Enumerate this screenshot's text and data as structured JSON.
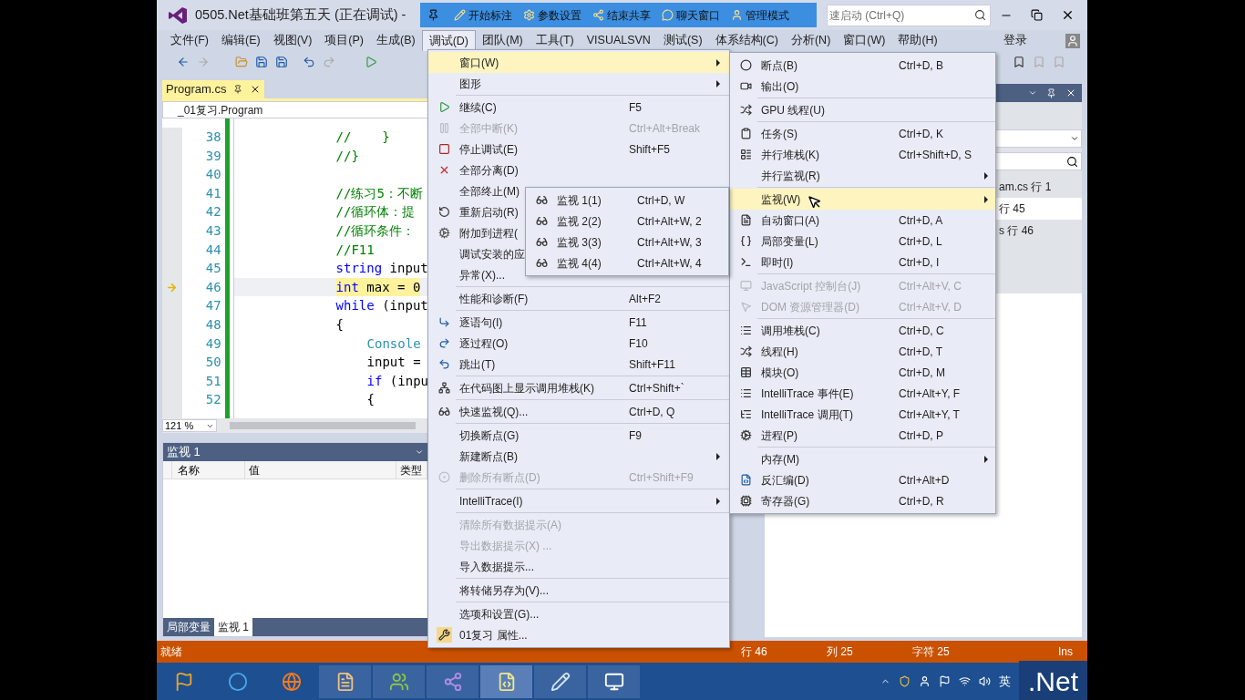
{
  "window": {
    "title": "0505.Net基础班第五天 (正在调试) -",
    "quick_launch": {
      "placeholder": "速启动 (Ctrl+Q)"
    }
  },
  "recorder_toolbar": {
    "items": [
      {
        "label": "开始标注"
      },
      {
        "label": "参数设置"
      },
      {
        "label": "结束共享"
      },
      {
        "label": "聊天窗口"
      },
      {
        "label": "管理模式"
      }
    ]
  },
  "menu_bar": {
    "items": [
      {
        "label": "文件(F)",
        "selected": false
      },
      {
        "label": "编辑(E)",
        "selected": false
      },
      {
        "label": "视图(V)",
        "selected": false
      },
      {
        "label": "项目(P)",
        "selected": false
      },
      {
        "label": "生成(B)",
        "selected": false
      },
      {
        "label": "调试(D)",
        "selected": true
      },
      {
        "label": "团队(M)",
        "selected": false
      },
      {
        "label": "工具(T)",
        "selected": false
      },
      {
        "label": "VISUALSVN",
        "selected": false
      },
      {
        "label": "测试(S)",
        "selected": false
      },
      {
        "label": "体系结构(C)",
        "selected": false
      },
      {
        "label": "分析(N)",
        "selected": false
      },
      {
        "label": "窗口(W)",
        "selected": false
      },
      {
        "label": "帮助(H)",
        "selected": false
      }
    ],
    "sign_in": "登录"
  },
  "editor": {
    "tab": "Program.cs",
    "navigation": "_01复习.Program",
    "zoom": "121 %",
    "lines": [
      {
        "number": "38",
        "current": false,
        "nested": false,
        "tokens": [
          {
            "text": "//    }",
            "kind": "comment"
          }
        ]
      },
      {
        "number": "39",
        "current": false,
        "nested": false,
        "tokens": [
          {
            "text": "//}",
            "kind": "comment"
          }
        ]
      },
      {
        "number": "40"
      },
      {
        "number": "41",
        "current": false,
        "nested": false,
        "tokens": [
          {
            "text": "//练习5：不断",
            "kind": "comment"
          }
        ]
      },
      {
        "number": "42",
        "current": false,
        "nested": false,
        "tokens": [
          {
            "text": "//循环体：提",
            "kind": "comment"
          }
        ]
      },
      {
        "number": "43",
        "current": false,
        "nested": false,
        "tokens": [
          {
            "text": "//循环条件：",
            "kind": "comment"
          }
        ]
      },
      {
        "number": "44",
        "current": false,
        "nested": false,
        "tokens": [
          {
            "text": "//F11",
            "kind": "comment"
          }
        ]
      },
      {
        "number": "45",
        "current": false,
        "nested": false,
        "tokens": [
          {
            "text": "string",
            "kind": "keyword"
          },
          {
            "text": " input",
            "kind": "plain"
          }
        ]
      },
      {
        "number": "46",
        "current": true,
        "nested": false,
        "tokens": [
          {
            "text": "int",
            "kind": "keyword"
          },
          {
            "text": " max = 0",
            "kind": "plain"
          }
        ]
      },
      {
        "number": "47",
        "current": false,
        "nested": false,
        "tokens": [
          {
            "text": "while",
            "kind": "keyword"
          },
          {
            "text": " (input",
            "kind": "plain"
          }
        ]
      },
      {
        "number": "48",
        "current": false,
        "nested": false,
        "tokens": [
          {
            "text": "{",
            "kind": "plain"
          }
        ]
      },
      {
        "number": "49",
        "current": false,
        "nested": true,
        "tokens": [
          {
            "text": "Console",
            "kind": "type"
          }
        ]
      },
      {
        "number": "50",
        "current": false,
        "nested": true,
        "tokens": [
          {
            "text": "input =",
            "kind": "plain"
          }
        ]
      },
      {
        "number": "51",
        "current": false,
        "nested": true,
        "tokens": [
          {
            "text": "if",
            "kind": "keyword"
          },
          {
            "text": " (inpu",
            "kind": "plain"
          }
        ]
      },
      {
        "number": "52",
        "current": false,
        "nested": true,
        "tokens": [
          {
            "text": "{",
            "kind": "plain"
          }
        ]
      }
    ]
  },
  "watch_panel": {
    "title": "监视 1",
    "columns": [
      "名称",
      "值",
      "类型"
    ],
    "tabs": [
      {
        "label": "局部变量",
        "selected": false
      },
      {
        "label": "监视 1",
        "selected": true
      }
    ]
  },
  "right_panel": {
    "rows": [
      {
        "text": "am.cs 行 1",
        "selected": false
      },
      {
        "text": "行 45",
        "selected": true
      },
      {
        "text": "s 行 46",
        "selected": false
      }
    ]
  },
  "debug_menu": {
    "groups": [
      {
        "items": [
          {
            "label": "窗口(W)",
            "submenu": true,
            "selected": true,
            "disabled": false
          },
          {
            "label": "图形",
            "submenu": true,
            "selected": false,
            "disabled": false
          }
        ]
      },
      {
        "items": [
          {
            "label": "继续(C)",
            "shortcut": "F5",
            "submenu": false,
            "selected": false,
            "disabled": false
          },
          {
            "label": "全部中断(K)",
            "shortcut": "Ctrl+Alt+Break",
            "submenu": false,
            "selected": false,
            "disabled": true
          },
          {
            "label": "停止调试(E)",
            "shortcut": "Shift+F5",
            "submenu": false,
            "selected": false,
            "disabled": false
          },
          {
            "label": "全部分离(D)",
            "submenu": false,
            "selected": false,
            "disabled": false
          },
          {
            "label": "全部终止(M)",
            "selected": false,
            "disabled": false
          },
          {
            "label": "重新启动(R)",
            "selected": false,
            "disabled": false
          },
          {
            "label": "附加到进程(",
            "selected": false,
            "disabled": false
          },
          {
            "label": "调试安装的应",
            "selected": false,
            "disabled": false
          },
          {
            "label": "异常(X)...",
            "submenu": false,
            "selected": false,
            "disabled": false
          }
        ]
      },
      {
        "items": [
          {
            "label": "性能和诊断(F)",
            "shortcut": "Alt+F2",
            "submenu": false,
            "selected": false,
            "disabled": false
          }
        ]
      },
      {
        "items": [
          {
            "label": "逐语句(I)",
            "shortcut": "F11",
            "submenu": false,
            "selected": false,
            "disabled": false
          },
          {
            "label": "逐过程(O)",
            "shortcut": "F10",
            "submenu": false,
            "selected": false,
            "disabled": false
          },
          {
            "label": "跳出(T)",
            "shortcut": "Shift+F11",
            "submenu": false,
            "selected": false,
            "disabled": false
          }
        ]
      },
      {
        "items": [
          {
            "label": "在代码图上显示调用堆栈(K)",
            "shortcut": "Ctrl+Shift+`",
            "submenu": false,
            "selected": false,
            "disabled": false
          }
        ]
      },
      {
        "items": [
          {
            "label": "快速监视(Q)...",
            "shortcut": "Ctrl+D, Q",
            "submenu": false,
            "selected": false,
            "disabled": false
          }
        ]
      },
      {
        "items": [
          {
            "label": "切换断点(G)",
            "shortcut": "F9",
            "submenu": false,
            "selected": false,
            "disabled": false
          },
          {
            "label": "新建断点(B)",
            "submenu": true,
            "selected": false,
            "disabled": false
          },
          {
            "label": "删除所有断点(D)",
            "shortcut": "Ctrl+Shift+F9",
            "submenu": false,
            "selected": false,
            "disabled": true
          }
        ]
      },
      {
        "items": [
          {
            "label": "IntelliTrace(I)",
            "submenu": true,
            "selected": false,
            "disabled": false
          }
        ]
      },
      {
        "items": [
          {
            "label": "清除所有数据提示(A)",
            "submenu": false,
            "selected": false,
            "disabled": true
          },
          {
            "label": "导出数据提示(X) ...",
            "submenu": false,
            "selected": false,
            "disabled": true
          },
          {
            "label": "导入数据提示...",
            "submenu": false,
            "selected": false,
            "disabled": false
          }
        ]
      },
      {
        "items": [
          {
            "label": "将转储另存为(V)...",
            "submenu": false,
            "selected": false,
            "disabled": false
          }
        ]
      },
      {
        "items": [
          {
            "label": "选项和设置(G)...",
            "submenu": false,
            "selected": false,
            "disabled": false
          },
          {
            "label": "01复习 属性...",
            "submenu": false,
            "selected": false,
            "disabled": false
          }
        ]
      }
    ]
  },
  "window_menu": {
    "groups": [
      {
        "items": [
          {
            "label": "断点(B)",
            "shortcut": "Ctrl+D, B",
            "submenu": false,
            "selected": false,
            "disabled": false
          },
          {
            "label": "输出(O)",
            "submenu": false,
            "selected": false,
            "disabled": false
          }
        ]
      },
      {
        "items": [
          {
            "label": "GPU 线程(U)",
            "submenu": false,
            "selected": false,
            "disabled": false
          }
        ]
      },
      {
        "items": [
          {
            "label": "任务(S)",
            "shortcut": "Ctrl+D, K",
            "submenu": false,
            "selected": false,
            "disabled": false
          },
          {
            "label": "并行堆栈(K)",
            "shortcut": "Ctrl+Shift+D, S",
            "submenu": false,
            "selected": false,
            "disabled": false
          },
          {
            "label": "并行监视(R)",
            "submenu": true,
            "selected": false,
            "disabled": false
          }
        ]
      },
      {
        "items": [
          {
            "label": "监视(W)",
            "submenu": true,
            "selected": true,
            "disabled": false
          },
          {
            "label": "自动窗口(A)",
            "shortcut": "Ctrl+D, A",
            "submenu": false,
            "selected": false,
            "disabled": false
          },
          {
            "label": "局部变量(L)",
            "shortcut": "Ctrl+D, L",
            "submenu": false,
            "selected": false,
            "disabled": false
          },
          {
            "label": "即时(I)",
            "shortcut": "Ctrl+D, I",
            "submenu": false,
            "selected": false,
            "disabled": false
          }
        ]
      },
      {
        "items": [
          {
            "label": "JavaScript 控制台(J)",
            "shortcut": "Ctrl+Alt+V, C",
            "submenu": false,
            "selected": false,
            "disabled": true
          },
          {
            "label": "DOM 资源管理器(D)",
            "shortcut": "Ctrl+Alt+V, D",
            "submenu": false,
            "selected": false,
            "disabled": true
          }
        ]
      },
      {
        "items": [
          {
            "label": "调用堆栈(C)",
            "shortcut": "Ctrl+D, C",
            "submenu": false,
            "selected": false,
            "disabled": false
          },
          {
            "label": "线程(H)",
            "shortcut": "Ctrl+D, T",
            "submenu": false,
            "selected": false,
            "disabled": false
          },
          {
            "label": "模块(O)",
            "shortcut": "Ctrl+D, M",
            "submenu": false,
            "selected": false,
            "disabled": false
          },
          {
            "label": "IntelliTrace 事件(E)",
            "shortcut": "Ctrl+Alt+Y, F",
            "submenu": false,
            "selected": false,
            "disabled": false
          },
          {
            "label": "IntelliTrace 调用(T)",
            "shortcut": "Ctrl+Alt+Y, T",
            "submenu": false,
            "selected": false,
            "disabled": false
          },
          {
            "label": "进程(P)",
            "shortcut": "Ctrl+D, P",
            "submenu": false,
            "selected": false,
            "disabled": false
          }
        ]
      },
      {
        "items": [
          {
            "label": "内存(M)",
            "submenu": true,
            "selected": false,
            "disabled": false
          },
          {
            "label": "反汇编(D)",
            "shortcut": "Ctrl+Alt+D",
            "submenu": false,
            "selected": false,
            "disabled": false
          },
          {
            "label": "寄存器(G)",
            "shortcut": "Ctrl+D, R",
            "submenu": false,
            "selected": false,
            "disabled": false
          }
        ]
      }
    ]
  },
  "watch_menu": {
    "groups": [
      {
        "items": [
          {
            "label": "监视 1(1)",
            "shortcut": "Ctrl+D, W",
            "submenu": false,
            "selected": false,
            "disabled": false
          },
          {
            "label": "监视 2(2)",
            "shortcut": "Ctrl+Alt+W, 2",
            "submenu": false,
            "selected": false,
            "disabled": false
          },
          {
            "label": "监视 3(3)",
            "shortcut": "Ctrl+Alt+W, 3",
            "submenu": false,
            "selected": false,
            "disabled": false
          },
          {
            "label": "监视 4(4)",
            "shortcut": "Ctrl+Alt+W, 4",
            "submenu": false,
            "selected": false,
            "disabled": false
          }
        ]
      }
    ]
  },
  "status_bar": {
    "message": "就绪",
    "line": "行 46",
    "column": "列 25",
    "char": "字符 25",
    "mode": "Ins"
  },
  "taskbar": {
    "input_method": "英",
    "brand": ".Net",
    "apps": [
      {
        "selected": false
      },
      {
        "selected": false
      },
      {
        "selected": false
      },
      {
        "selected": false
      },
      {
        "selected": false
      },
      {
        "selected": false
      },
      {
        "selected": true
      },
      {
        "selected": false
      },
      {
        "selected": false
      }
    ]
  }
}
